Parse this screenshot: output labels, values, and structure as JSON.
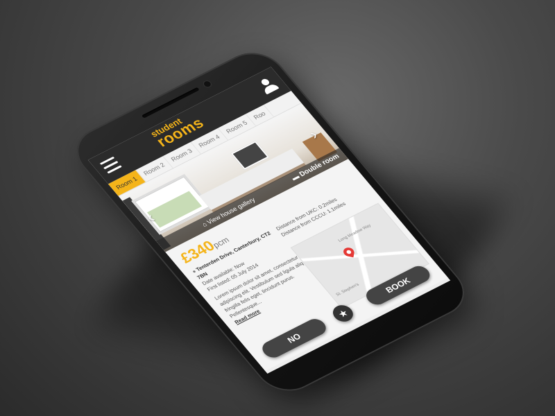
{
  "app": {
    "logo_line1": "student",
    "logo_line2": "rooms"
  },
  "header": {
    "menu_icon": "hamburger-menu-icon",
    "user_icon": "user-profile-icon"
  },
  "tabs": [
    {
      "label": "Room 1",
      "active": true
    },
    {
      "label": "Room 2",
      "active": false
    },
    {
      "label": "Room 3",
      "active": false
    },
    {
      "label": "Room 4",
      "active": false
    },
    {
      "label": "Room 5",
      "active": false
    },
    {
      "label": "Roo",
      "active": false
    }
  ],
  "gallery": {
    "view_label": "View house gallery",
    "room_type": "Double room"
  },
  "listing": {
    "price": "£340",
    "price_unit": "pcm",
    "address": "Tenterden Drive, Canterbury, CT2 7BN",
    "date_available": "Date available: Now",
    "first_listed": "First listed: 05 July 2014",
    "distance_ukc": "Distance from UKC: 0.2miles",
    "distance_cccu": "Distance from CCCU: 1.1miles",
    "description": "Lorem ipsum dolor sit amet, consectetur adipiscing elit. Vestibulum sed ligula aliquet, fringilla felis eget, tincidunt purus. Pellentesque...",
    "read_more": "Read more"
  },
  "map": {
    "road_label": "Long Meadow Way",
    "road_label2": "St. Stephen's"
  },
  "actions": {
    "no_label": "NO",
    "book_label": "BOOK",
    "star_icon": "favorite-star-icon"
  },
  "colors": {
    "accent": "#f4b41a",
    "topbar": "#2b2b2b",
    "button": "#444444"
  }
}
